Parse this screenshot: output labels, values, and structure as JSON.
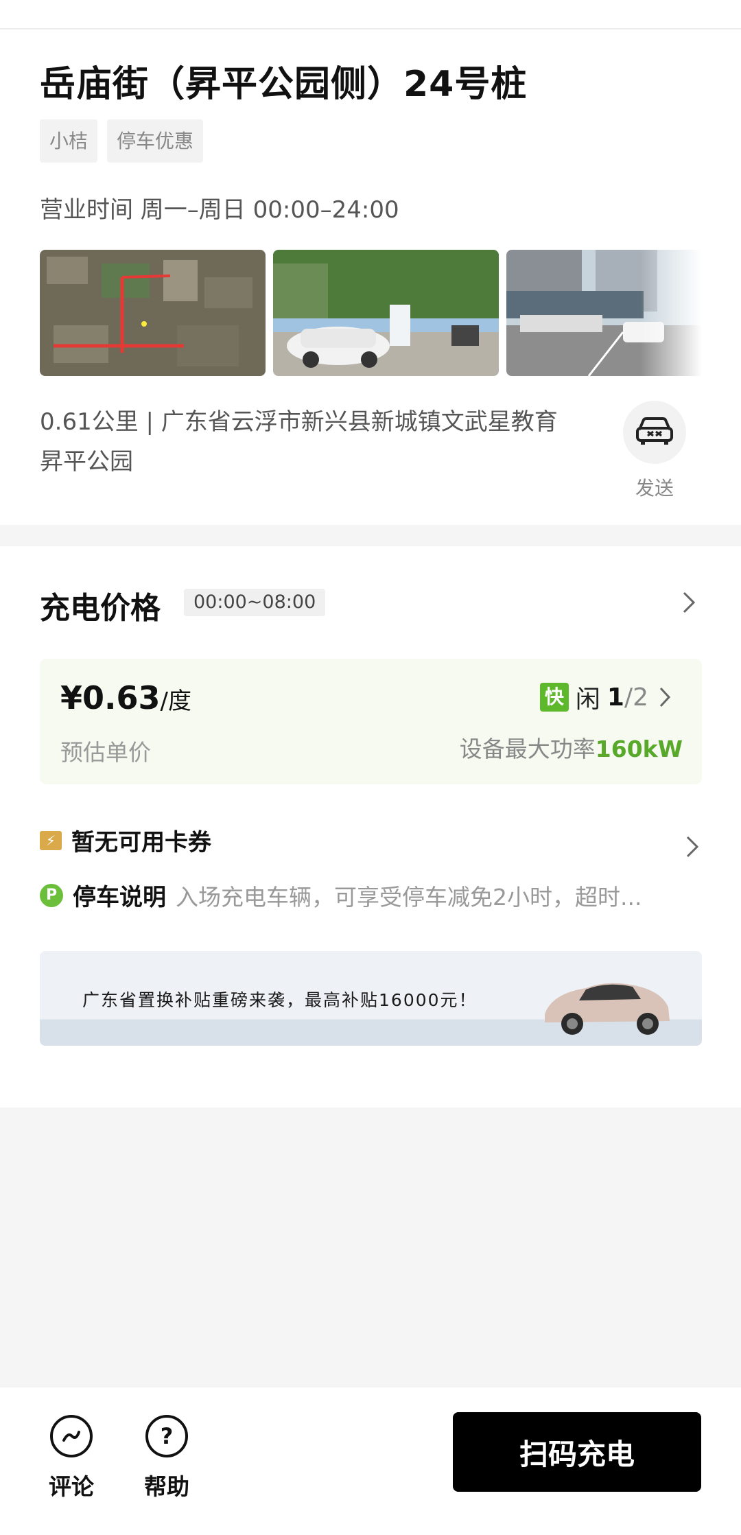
{
  "station": {
    "title": "岳庙街（昇平公园侧）24号桩",
    "tags": [
      "小桔",
      "停车优惠"
    ],
    "hours": "营业时间 周一–周日 00:00–24:00",
    "address": "0.61公里 | 广东省云浮市新兴县新城镇文武星教育昇平公园",
    "send_label": "发送"
  },
  "price": {
    "section_title": "充电价格",
    "time_range": "00:00~08:00",
    "value": "¥0.63",
    "unit": "/度",
    "sub_label": "预估单价",
    "fast_badge": "快",
    "status": "闲",
    "available": "1",
    "total": "/2",
    "power_label": "设备最大功率",
    "power_value": "160kW"
  },
  "coupon": {
    "text": "暂无可用卡券"
  },
  "parking": {
    "label": "停车说明",
    "desc": "入场充电车辆，可享受停车减免2小时，超时..."
  },
  "banner": {
    "text": "广东省置换补贴重磅来袭，最高补贴16000元！"
  },
  "bottom_bar": {
    "comment_label": "评论",
    "help_label": "帮助",
    "scan_label": "扫码充电"
  },
  "colors": {
    "accent_green": "#58a82a",
    "fast_badge": "#5db82c",
    "button_black": "#000000"
  }
}
